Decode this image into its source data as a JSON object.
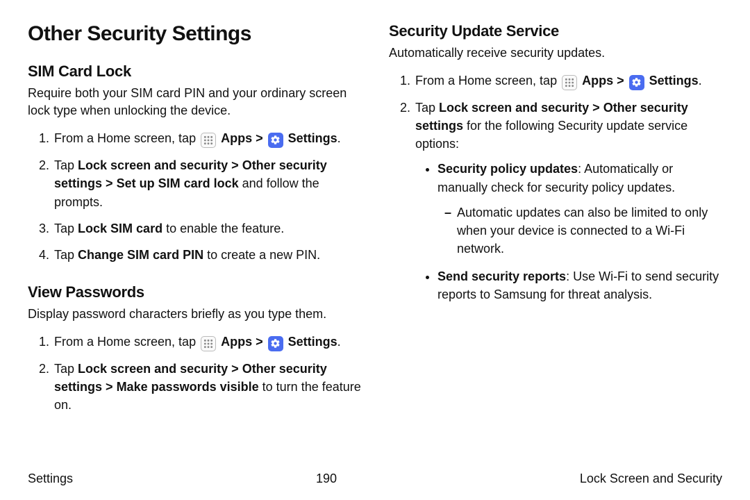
{
  "page_title": "Other Security Settings",
  "left": {
    "section1": {
      "heading": "SIM Card Lock",
      "desc": "Require both your SIM card PIN and your ordinary screen lock type when unlocking the device.",
      "step1_lead": "From a Home screen, tap ",
      "step1_apps": "Apps",
      "step1_settings": "Settings",
      "step2_a": "Tap ",
      "step2_b": "Lock screen and security",
      "step2_c": "Other security settings",
      "step2_d": "Set up SIM card lock",
      "step2_e": " and follow the prompts.",
      "step3_a": "Tap ",
      "step3_b": "Lock SIM card",
      "step3_c": " to enable the feature.",
      "step4_a": "Tap ",
      "step4_b": "Change SIM card PIN",
      "step4_c": " to create a new PIN."
    },
    "section2": {
      "heading": "View Passwords",
      "desc": "Display password characters briefly as you type them.",
      "step1_lead": "From a Home screen, tap ",
      "step1_apps": "Apps",
      "step1_settings": "Settings",
      "step2_a": "Tap ",
      "step2_b": "Lock screen and security",
      "step2_c": "Other security settings",
      "step2_d": "Make passwords visible",
      "step2_e": " to turn the feature on."
    }
  },
  "right": {
    "section1": {
      "heading": "Security Update Service",
      "desc": "Automatically receive security updates.",
      "step1_lead": "From a Home screen, tap ",
      "step1_apps": "Apps",
      "step1_settings": "Settings",
      "step2_a": "Tap ",
      "step2_b": "Lock screen and security",
      "step2_c": "Other security settings",
      "step2_e": " for the following Security update service options:",
      "bullet1_b": "Security policy updates",
      "bullet1_rest": ": Automatically or manually check for security policy updates.",
      "dash1": "Automatic updates can also be limited to only when your device is connected to a Wi‑Fi network.",
      "bullet2_b": "Send security reports",
      "bullet2_rest": ": Use Wi‑Fi to send security reports to Samsung for threat analysis."
    }
  },
  "footer": {
    "left": "Settings",
    "center": "190",
    "right": "Lock Screen and Security"
  },
  "chevron": ">",
  "period": "."
}
